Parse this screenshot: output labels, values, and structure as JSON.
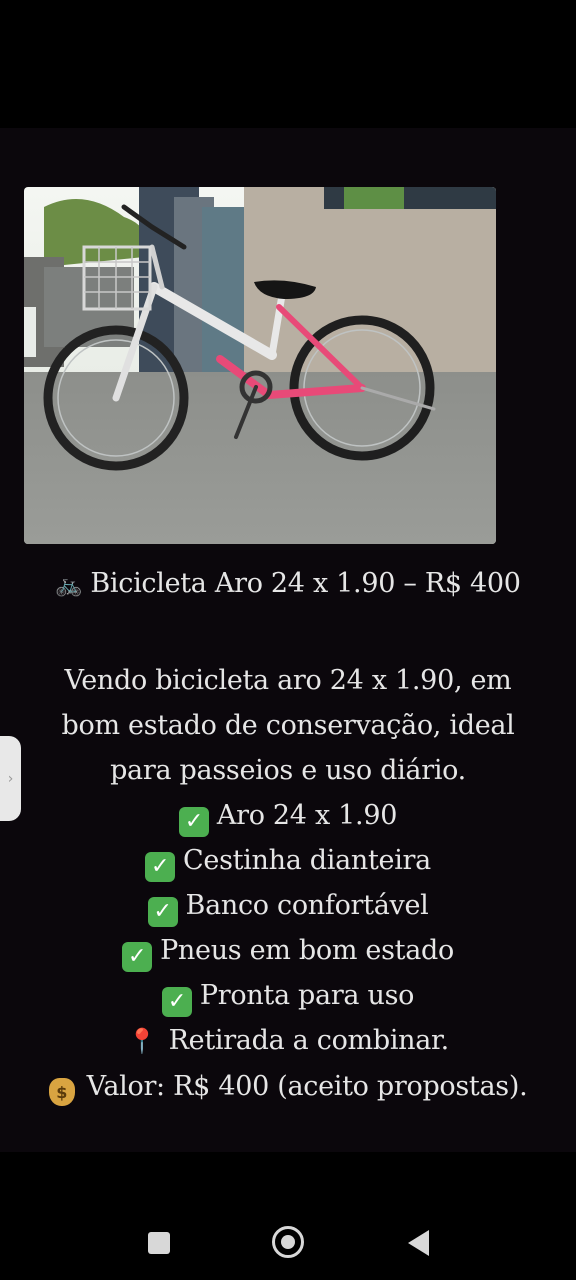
{
  "post": {
    "title_icon": "bicycle-icon",
    "title": "Bicicleta Aro 24 x 1.90 – R$ 400",
    "description_lines": [
      "Vendo bicicleta aro 24 x 1.90, em",
      "bom estado de conservação, ideal",
      "para passeios e uso diário."
    ],
    "features": [
      "Aro 24 x 1.90",
      "Cestinha dianteira",
      "Banco confortável",
      "Pneus em bom estado",
      "Pronta para uso"
    ],
    "pickup": "Retirada a combinar.",
    "price": "Valor: R$ 400 (aceito propostas)."
  },
  "icons": {
    "feature": "check-mark-icon",
    "pickup": "pin-icon",
    "price": "money-bag-icon",
    "side_handle": "chevron-right-icon"
  },
  "navigation": {
    "buttons": [
      "recent-apps",
      "home",
      "back"
    ]
  },
  "colors": {
    "background": "#0b070c",
    "text": "#e6e6e6",
    "check": "#4caf50",
    "bike_frame_pink": "#e84a78"
  }
}
